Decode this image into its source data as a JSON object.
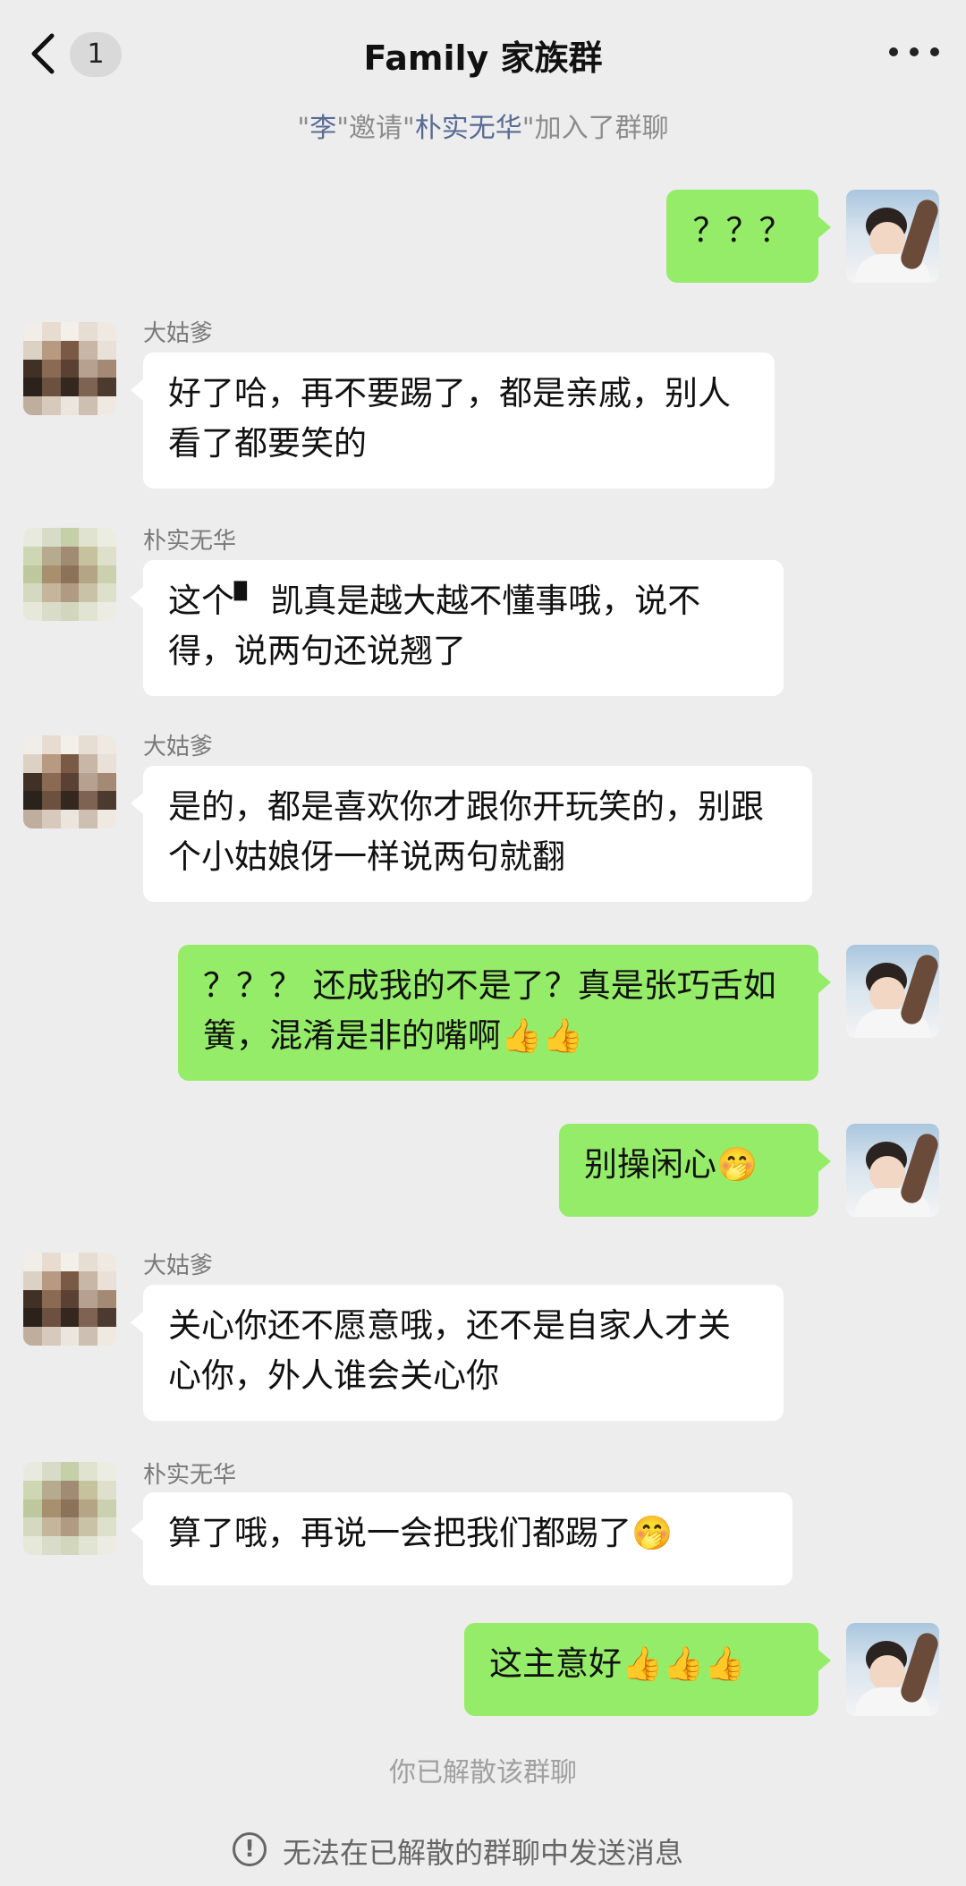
{
  "header": {
    "back_count": "1",
    "title": "Family 家族群"
  },
  "system": {
    "invite_prefix": "\"",
    "inviter": "李",
    "invite_mid1": "\"邀请\"",
    "invitee": "朴实无华",
    "invite_suffix": "\"加入了群聊",
    "disbanded": "你已解散该群聊",
    "footer_notice": "无法在已解散的群聊中发送消息"
  },
  "messages": [
    {
      "side": "out",
      "sender": "",
      "text": "？？？"
    },
    {
      "side": "in",
      "sender": "大姑爹",
      "text": "好了哈，再不要踢了，都是亲戚，别人看了都要笑的"
    },
    {
      "side": "in",
      "sender": "朴实无华",
      "text": "这个▘ 凯真是越大越不懂事哦，说不得，说两句还说翘了"
    },
    {
      "side": "in",
      "sender": "大姑爹",
      "text": "是的，都是喜欢你才跟你开玩笑的，别跟个小姑娘伢一样说两句就翻"
    },
    {
      "side": "out",
      "sender": "",
      "text": "？？？ 还成我的不是了？真是张巧舌如簧，混淆是非的嘴啊👍👍"
    },
    {
      "side": "out",
      "sender": "",
      "text": "别操闲心🤭"
    },
    {
      "side": "in",
      "sender": "大姑爹",
      "text": "关心你还不愿意哦，还不是自家人才关心你，外人谁会关心你"
    },
    {
      "side": "in",
      "sender": "朴实无华",
      "text": "算了哦，再说一会把我们都踢了🤭"
    },
    {
      "side": "out",
      "sender": "",
      "text": "这主意好👍👍👍"
    }
  ],
  "icons": [
    "back-chevron-icon",
    "more-dots-icon",
    "info-circle-icon"
  ],
  "colors": {
    "background": "#ededed",
    "outgoing_bubble": "#95ec69",
    "incoming_bubble": "#ffffff",
    "name_link": "#576b95"
  }
}
